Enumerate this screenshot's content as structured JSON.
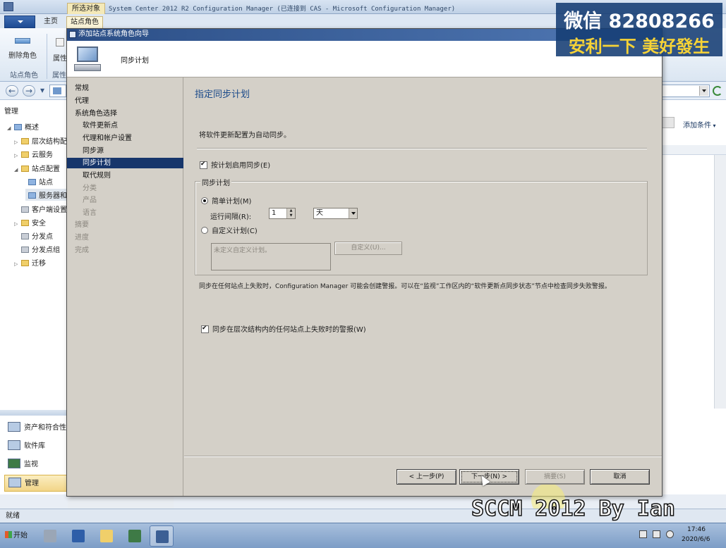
{
  "console": {
    "context_tab": "所选对象",
    "title": "System Center 2012 R2 Configuration Manager (已连接到 CAS - Microsoft Configuration Manager)",
    "ribbon_tabs": [
      "主页",
      "站点角色"
    ],
    "ribbon_buttons": {
      "delete_role": "删除角色",
      "properties": "属性"
    },
    "ribbon_groups": {
      "site_role": "站点角色",
      "properties": "属性"
    },
    "add_condition": "添加条件"
  },
  "navigation": {
    "heading": "管理",
    "tree": [
      {
        "label": "概述",
        "icon": "overview-icon",
        "level": 0,
        "expanded": true
      },
      {
        "label": "层次结构配",
        "icon": "folder-icon",
        "level": 1
      },
      {
        "label": "云服务",
        "icon": "folder-icon",
        "level": 1
      },
      {
        "label": "站点配置",
        "icon": "folder-icon",
        "level": 1,
        "expanded": true
      },
      {
        "label": "站点",
        "icon": "site-icon",
        "level": 2
      },
      {
        "label": "服务器和",
        "icon": "server-icon",
        "level": 2,
        "selected": true
      },
      {
        "label": "客户端设置",
        "icon": "client-settings-icon",
        "level": 1
      },
      {
        "label": "安全",
        "icon": "folder-icon",
        "level": 1
      },
      {
        "label": "分发点",
        "icon": "distribution-point-icon",
        "level": 1
      },
      {
        "label": "分发点组",
        "icon": "distribution-group-icon",
        "level": 1
      },
      {
        "label": "迁移",
        "icon": "folder-icon",
        "level": 1
      }
    ],
    "workspaces": [
      {
        "label": "资产和符合性",
        "icon": "assets-icon"
      },
      {
        "label": "软件库",
        "icon": "software-library-icon"
      },
      {
        "label": "监视",
        "icon": "monitoring-icon"
      },
      {
        "label": "管理",
        "icon": "administration-icon",
        "active": true
      }
    ]
  },
  "status_bar": {
    "text": "就绪"
  },
  "taskbar": {
    "start": "开始",
    "time": "17:46",
    "date": "2020/6/6"
  },
  "wizard": {
    "title": "添加站点系统角色向导",
    "header_title": "同步计划",
    "steps": [
      {
        "label": "常规",
        "indent": false,
        "state": "normal"
      },
      {
        "label": "代理",
        "indent": false,
        "state": "normal"
      },
      {
        "label": "系统角色选择",
        "indent": false,
        "state": "normal"
      },
      {
        "label": "软件更新点",
        "indent": true,
        "state": "normal"
      },
      {
        "label": "代理和帐户设置",
        "indent": true,
        "state": "normal"
      },
      {
        "label": "同步源",
        "indent": true,
        "state": "normal"
      },
      {
        "label": "同步计划",
        "indent": true,
        "state": "current"
      },
      {
        "label": "取代规则",
        "indent": true,
        "state": "normal"
      },
      {
        "label": "分类",
        "indent": true,
        "state": "disabled"
      },
      {
        "label": "产品",
        "indent": true,
        "state": "disabled"
      },
      {
        "label": "语言",
        "indent": true,
        "state": "disabled"
      },
      {
        "label": "摘要",
        "indent": false,
        "state": "disabled"
      },
      {
        "label": "进度",
        "indent": false,
        "state": "disabled"
      },
      {
        "label": "完成",
        "indent": false,
        "state": "disabled"
      }
    ],
    "page_heading": "指定同步计划",
    "description": "将软件更新配置为自动同步。",
    "enable_schedule": {
      "label": "按计划启用同步(E)",
      "checked": true
    },
    "group_label": "同步计划",
    "simple_schedule": {
      "label": "简单计划(M)",
      "selected": true
    },
    "interval_label": "运行间隔(R):",
    "interval_value": "1",
    "interval_unit": "天",
    "custom_schedule": {
      "label": "自定义计划(C)",
      "selected": false
    },
    "custom_placeholder": "未定义自定义计划。",
    "custom_button": "自定义(U)...",
    "warning_text": "同步在任何站点上失败时，Configuration Manager 可能会创建警报。可以在“监视”工作区内的“软件更新点同步状态”节点中检查同步失败警报。",
    "alert_checkbox": {
      "label": "同步在层次结构内的任何站点上失败时的警报(W)",
      "checked": true
    },
    "buttons": {
      "back": "< 上一步(P)",
      "next": "下一步(N) >",
      "summary": "摘要(S)",
      "cancel": "取消"
    }
  },
  "overlay": {
    "wechat": "微信 82808266",
    "slogan": "安利一下 美好發生",
    "caption": "SCCM 2012 By Ian"
  },
  "colors": {
    "wizard_face": "#d4d0c8",
    "selection": "#17366b",
    "heading": "#1b4a8a",
    "console_bg": "#e9eef5"
  }
}
